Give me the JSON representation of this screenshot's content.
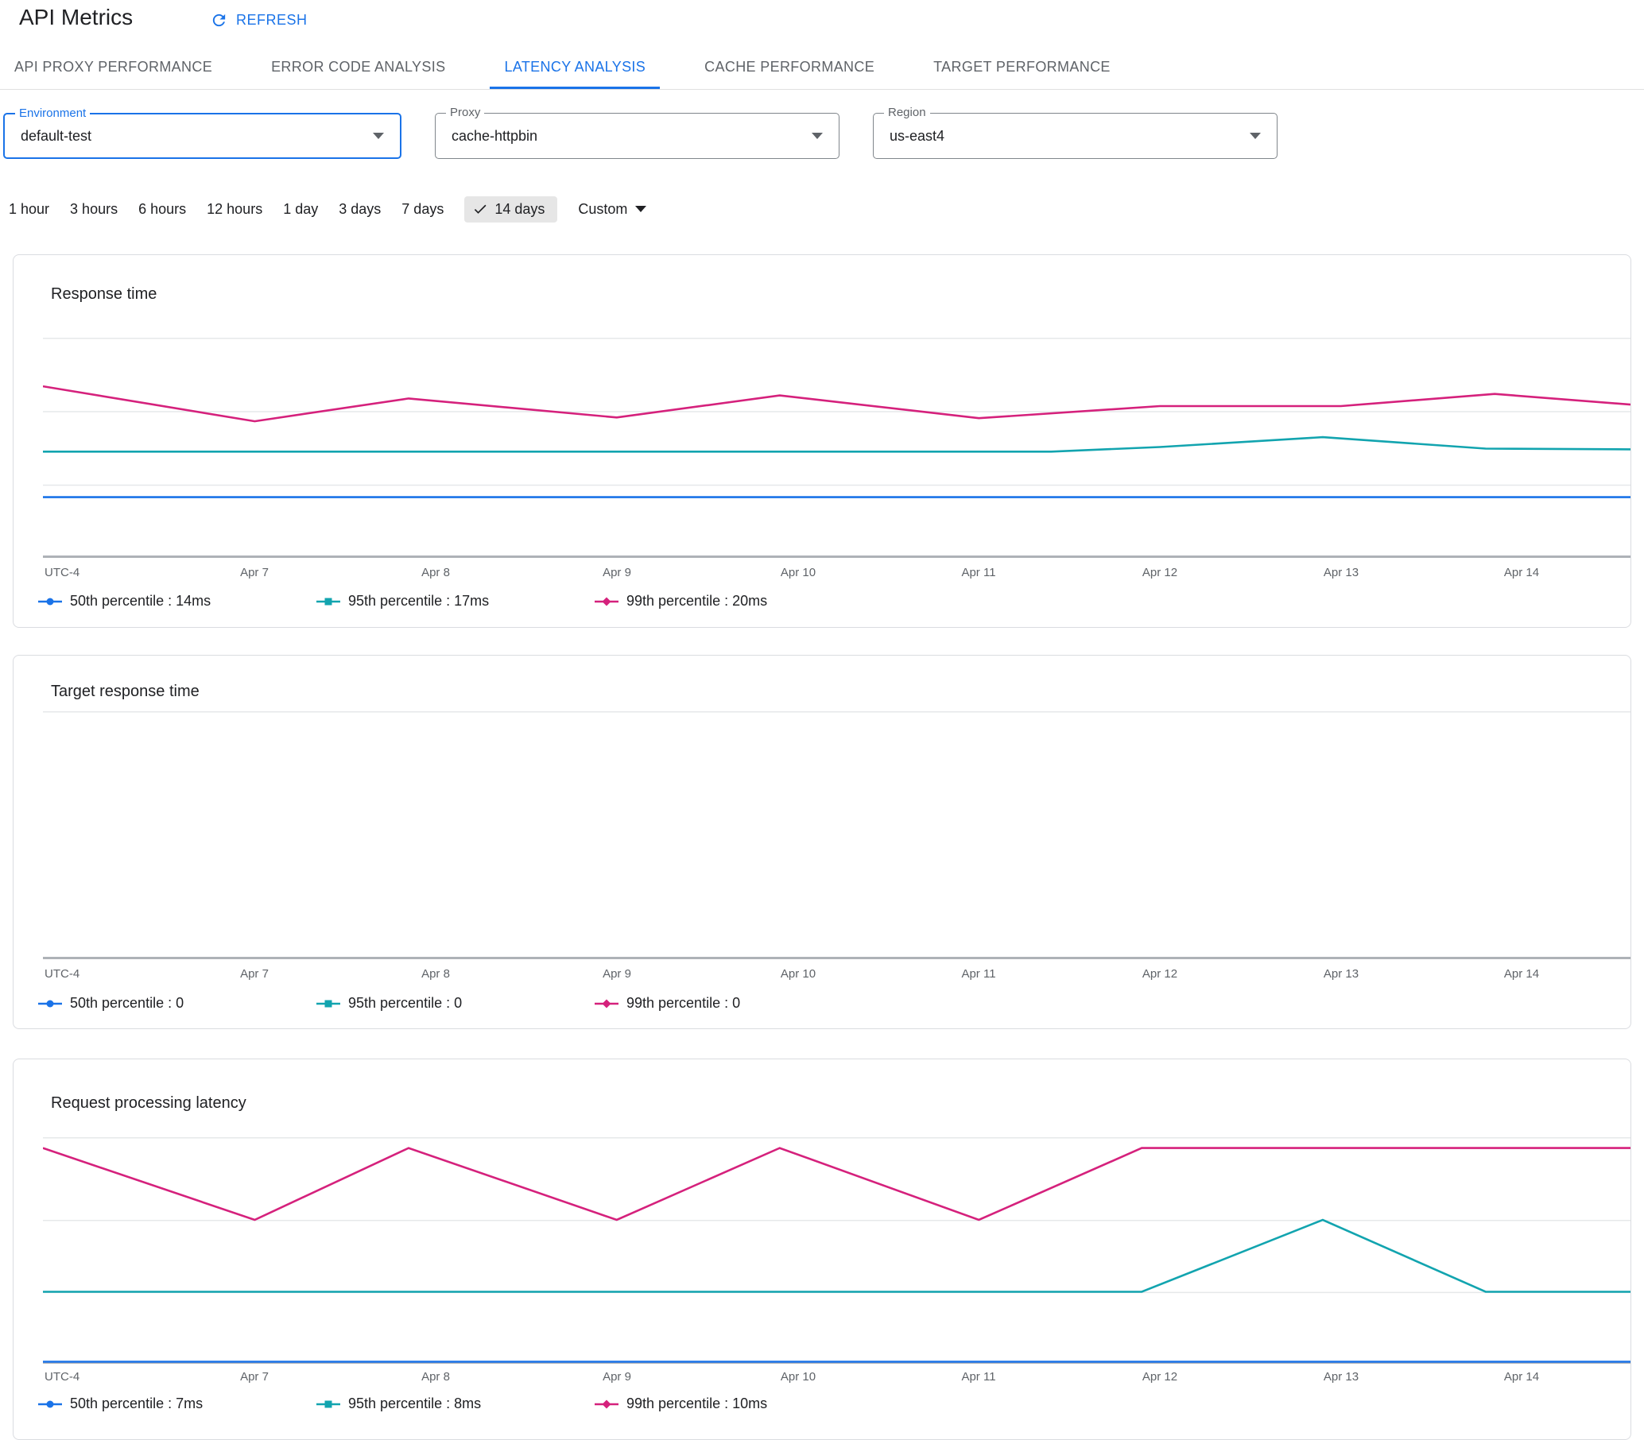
{
  "header": {
    "title": "API Metrics",
    "refresh_label": "REFRESH"
  },
  "tabs": [
    {
      "label": "API PROXY PERFORMANCE",
      "active": false
    },
    {
      "label": "ERROR CODE ANALYSIS",
      "active": false
    },
    {
      "label": "LATENCY ANALYSIS",
      "active": true
    },
    {
      "label": "CACHE PERFORMANCE",
      "active": false
    },
    {
      "label": "TARGET PERFORMANCE",
      "active": false
    }
  ],
  "filters": [
    {
      "label": "Environment",
      "value": "default-test",
      "focused": true
    },
    {
      "label": "Proxy",
      "value": "cache-httpbin",
      "focused": false
    },
    {
      "label": "Region",
      "value": "us-east4",
      "focused": false
    }
  ],
  "time_ranges": {
    "options": [
      "1 hour",
      "3 hours",
      "6 hours",
      "12 hours",
      "1 day",
      "3 days",
      "7 days"
    ],
    "selected_label": "14 days",
    "custom_label": "Custom"
  },
  "colors": {
    "accent": "#1a73e8",
    "p50": "#1a73e8",
    "p95": "#12a4af",
    "p99": "#d5217c"
  },
  "chart_data": [
    {
      "type": "line",
      "title": "Response time",
      "x_axis_left_label": "UTC-4",
      "xlim": [
        5.83,
        14.6
      ],
      "ylim": [
        10,
        24.5
      ],
      "gridlines_frac": [
        0,
        0.333,
        0.667
      ],
      "x_ticks": [
        {
          "x": 7,
          "label": "Apr 7"
        },
        {
          "x": 8,
          "label": "Apr 8"
        },
        {
          "x": 9,
          "label": "Apr 9"
        },
        {
          "x": 10,
          "label": "Apr 10"
        },
        {
          "x": 11,
          "label": "Apr 11"
        },
        {
          "x": 12,
          "label": "Apr 12"
        },
        {
          "x": 13,
          "label": "Apr 13"
        },
        {
          "x": 14,
          "label": "Apr 14"
        }
      ],
      "series": [
        {
          "name": "50th percentile",
          "value": "14ms",
          "legend_label": "50th percentile : 14ms",
          "color": "#1a73e8",
          "marker": "circle",
          "points": [
            [
              5.83,
              14
            ],
            [
              14.6,
              14
            ]
          ]
        },
        {
          "name": "95th percentile",
          "value": "17ms",
          "legend_label": "95th percentile : 17ms",
          "color": "#12a4af",
          "marker": "square",
          "points": [
            [
              5.83,
              17
            ],
            [
              11.4,
              17
            ],
            [
              12,
              17.3
            ],
            [
              12.9,
              17.95
            ],
            [
              13.8,
              17.2
            ],
            [
              14.6,
              17.15
            ]
          ]
        },
        {
          "name": "99th percentile",
          "value": "20ms",
          "legend_label": "99th percentile : 20ms",
          "color": "#d5217c",
          "marker": "diamond",
          "points": [
            [
              5.83,
              21.3
            ],
            [
              7,
              19
            ],
            [
              7.85,
              20.5
            ],
            [
              9,
              19.25
            ],
            [
              9.9,
              20.7
            ],
            [
              11,
              19.2
            ],
            [
              12,
              20
            ],
            [
              13,
              20
            ],
            [
              13.85,
              20.8
            ],
            [
              14.6,
              20.1
            ]
          ]
        }
      ]
    },
    {
      "type": "line",
      "title": "Target response time",
      "x_axis_left_label": "UTC-4",
      "xlim": [
        5.83,
        14.6
      ],
      "ylim": [
        0,
        1
      ],
      "gridlines_frac": [
        0
      ],
      "x_ticks": [
        {
          "x": 7,
          "label": "Apr 7"
        },
        {
          "x": 8,
          "label": "Apr 8"
        },
        {
          "x": 9,
          "label": "Apr 9"
        },
        {
          "x": 10,
          "label": "Apr 10"
        },
        {
          "x": 11,
          "label": "Apr 11"
        },
        {
          "x": 12,
          "label": "Apr 12"
        },
        {
          "x": 13,
          "label": "Apr 13"
        },
        {
          "x": 14,
          "label": "Apr 14"
        }
      ],
      "series": [
        {
          "name": "50th percentile",
          "value": "0",
          "legend_label": "50th percentile : 0",
          "color": "#1a73e8",
          "marker": "circle",
          "points": []
        },
        {
          "name": "95th percentile",
          "value": "0",
          "legend_label": "95th percentile : 0",
          "color": "#12a4af",
          "marker": "square",
          "points": []
        },
        {
          "name": "99th percentile",
          "value": "0",
          "legend_label": "99th percentile : 0",
          "color": "#d5217c",
          "marker": "diamond",
          "points": []
        }
      ]
    },
    {
      "type": "line",
      "title": "Request processing latency",
      "x_axis_left_label": "UTC-4",
      "xlim": [
        5.83,
        14.6
      ],
      "ylim": [
        7,
        10.15
      ],
      "gridlines_frac": [
        0,
        0.365,
        0.683
      ],
      "x_ticks": [
        {
          "x": 7,
          "label": "Apr 7"
        },
        {
          "x": 8,
          "label": "Apr 8"
        },
        {
          "x": 9,
          "label": "Apr 9"
        },
        {
          "x": 10,
          "label": "Apr 10"
        },
        {
          "x": 11,
          "label": "Apr 11"
        },
        {
          "x": 12,
          "label": "Apr 12"
        },
        {
          "x": 13,
          "label": "Apr 13"
        },
        {
          "x": 14,
          "label": "Apr 14"
        }
      ],
      "series": [
        {
          "name": "50th percentile",
          "value": "7ms",
          "legend_label": "50th percentile : 7ms",
          "color": "#1a73e8",
          "marker": "circle",
          "points": [
            [
              5.83,
              7
            ],
            [
              14.6,
              7
            ]
          ]
        },
        {
          "name": "95th percentile",
          "value": "8ms",
          "legend_label": "95th percentile : 8ms",
          "color": "#12a4af",
          "marker": "square",
          "points": [
            [
              5.83,
              8
            ],
            [
              11.9,
              8
            ],
            [
              12.9,
              9
            ],
            [
              13.8,
              8
            ],
            [
              14.6,
              8
            ]
          ]
        },
        {
          "name": "99th percentile",
          "value": "10ms",
          "legend_label": "99th percentile : 10ms",
          "color": "#d5217c",
          "marker": "diamond",
          "points": [
            [
              5.83,
              10
            ],
            [
              7,
              9
            ],
            [
              7.85,
              10
            ],
            [
              9,
              9
            ],
            [
              9.9,
              10
            ],
            [
              11,
              9
            ],
            [
              11.9,
              10
            ],
            [
              14.6,
              10
            ]
          ]
        }
      ]
    }
  ]
}
